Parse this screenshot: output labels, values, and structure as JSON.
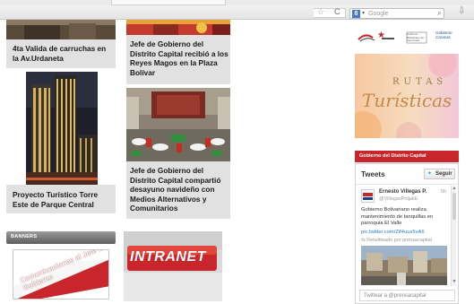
{
  "browser": {
    "search_placeholder": "Google",
    "search_engine_letter": "8",
    "refresh_glyph": "C"
  },
  "news": [
    {
      "title": "4ta Valida de carruchas en la Av.Urdaneta"
    },
    {
      "title": "Jefe de Gobierno del Distrito Capital recibió a los Reyes Magos en la Plaza Bolívar"
    },
    {
      "title": "Proyecto Turístico Torre Este de Parque Central"
    },
    {
      "title": "Jefe de Gobierno del Distrito Capital compartió desayuno navideño con Medios Alternativos y Comunitarios"
    }
  ],
  "banners": {
    "header": "BANNERS",
    "comunicaciones_text": "Comunicaciones al Jefe de Gobierno",
    "intranet_text": "INTRANET"
  },
  "sidebar": {
    "rutas_top": "RUTAS",
    "rutas_bottom": "Turísticas",
    "gov_header": "Gobierno del Distrito Capital",
    "logos": [
      "★",
      "Gobierno Bolivariano de Venezuela",
      "Gobierno Caracas"
    ]
  },
  "tweets": {
    "title": "Tweets",
    "follow_label": "Seguir",
    "author": "Ernesto Villegas P.",
    "handle": "@VillegasPoljakE",
    "time": "5h",
    "body": "Gobierno Bolivariano realiza mantenimiento de tanquillas en parroquia El Valle",
    "link": "pic.twitter.com/Zif4uux5vA6",
    "retweeted_by": "Retwitteado por prensacapital",
    "compose_placeholder": "Twittear a @prensacapital"
  },
  "colors": {
    "card_bg": "#e1e1e1",
    "gov_red": "#c8262c",
    "twitter_blue": "#2ea2e0",
    "link_blue": "#2b7bb9"
  }
}
